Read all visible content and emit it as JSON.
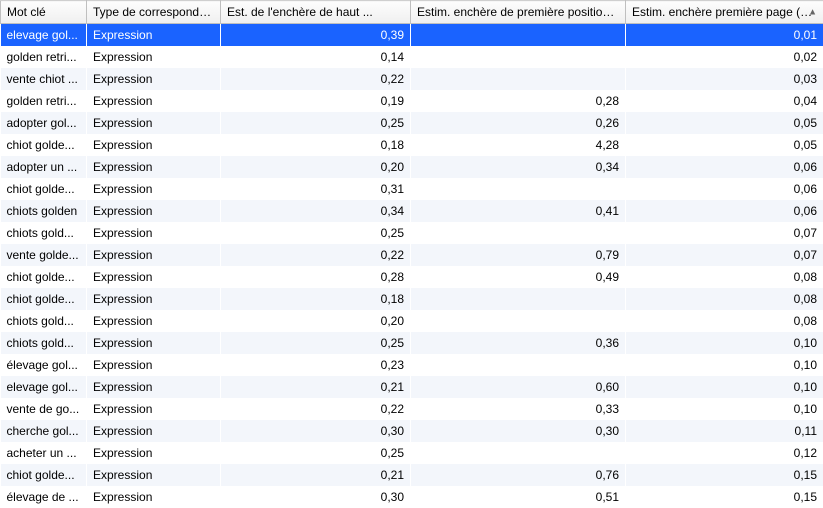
{
  "header": {
    "keyword": "Mot clé",
    "match": "Type de correspondance",
    "top_bid": "Est. de l'enchère de haut ...",
    "first_pos": "Estim. enchère de première position (E...",
    "first_page": "Estim. enchère première page (E...",
    "sort_indicator": "▲"
  },
  "rows": [
    {
      "kw": "elevage gol...",
      "match": "Expression",
      "top": "0,39",
      "pos": "",
      "page": "0,01",
      "selected": true
    },
    {
      "kw": "golden retri...",
      "match": "Expression",
      "top": "0,14",
      "pos": "",
      "page": "0,02"
    },
    {
      "kw": "vente chiot ...",
      "match": "Expression",
      "top": "0,22",
      "pos": "",
      "page": "0,03"
    },
    {
      "kw": "golden retri...",
      "match": "Expression",
      "top": "0,19",
      "pos": "0,28",
      "page": "0,04"
    },
    {
      "kw": "adopter gol...",
      "match": "Expression",
      "top": "0,25",
      "pos": "0,26",
      "page": "0,05"
    },
    {
      "kw": "chiot golde...",
      "match": "Expression",
      "top": "0,18",
      "pos": "4,28",
      "page": "0,05"
    },
    {
      "kw": "adopter un ...",
      "match": "Expression",
      "top": "0,20",
      "pos": "0,34",
      "page": "0,06"
    },
    {
      "kw": "chiot golde...",
      "match": "Expression",
      "top": "0,31",
      "pos": "",
      "page": "0,06"
    },
    {
      "kw": "chiots golden",
      "match": "Expression",
      "top": "0,34",
      "pos": "0,41",
      "page": "0,06"
    },
    {
      "kw": "chiots gold...",
      "match": "Expression",
      "top": "0,25",
      "pos": "",
      "page": "0,07"
    },
    {
      "kw": "vente golde...",
      "match": "Expression",
      "top": "0,22",
      "pos": "0,79",
      "page": "0,07"
    },
    {
      "kw": "chiot golde...",
      "match": "Expression",
      "top": "0,28",
      "pos": "0,49",
      "page": "0,08"
    },
    {
      "kw": "chiot golde...",
      "match": "Expression",
      "top": "0,18",
      "pos": "",
      "page": "0,08"
    },
    {
      "kw": "chiots gold...",
      "match": "Expression",
      "top": "0,20",
      "pos": "",
      "page": "0,08"
    },
    {
      "kw": "chiots gold...",
      "match": "Expression",
      "top": "0,25",
      "pos": "0,36",
      "page": "0,10"
    },
    {
      "kw": "élevage gol...",
      "match": "Expression",
      "top": "0,23",
      "pos": "",
      "page": "0,10"
    },
    {
      "kw": "elevage gol...",
      "match": "Expression",
      "top": "0,21",
      "pos": "0,60",
      "page": "0,10"
    },
    {
      "kw": "vente de go...",
      "match": "Expression",
      "top": "0,22",
      "pos": "0,33",
      "page": "0,10"
    },
    {
      "kw": "cherche gol...",
      "match": "Expression",
      "top": "0,30",
      "pos": "0,30",
      "page": "0,11"
    },
    {
      "kw": "acheter un ...",
      "match": "Expression",
      "top": "0,25",
      "pos": "",
      "page": "0,12"
    },
    {
      "kw": "chiot golde...",
      "match": "Expression",
      "top": "0,21",
      "pos": "0,76",
      "page": "0,15"
    },
    {
      "kw": "élevage de ...",
      "match": "Expression",
      "top": "0,30",
      "pos": "0,51",
      "page": "0,15"
    }
  ]
}
